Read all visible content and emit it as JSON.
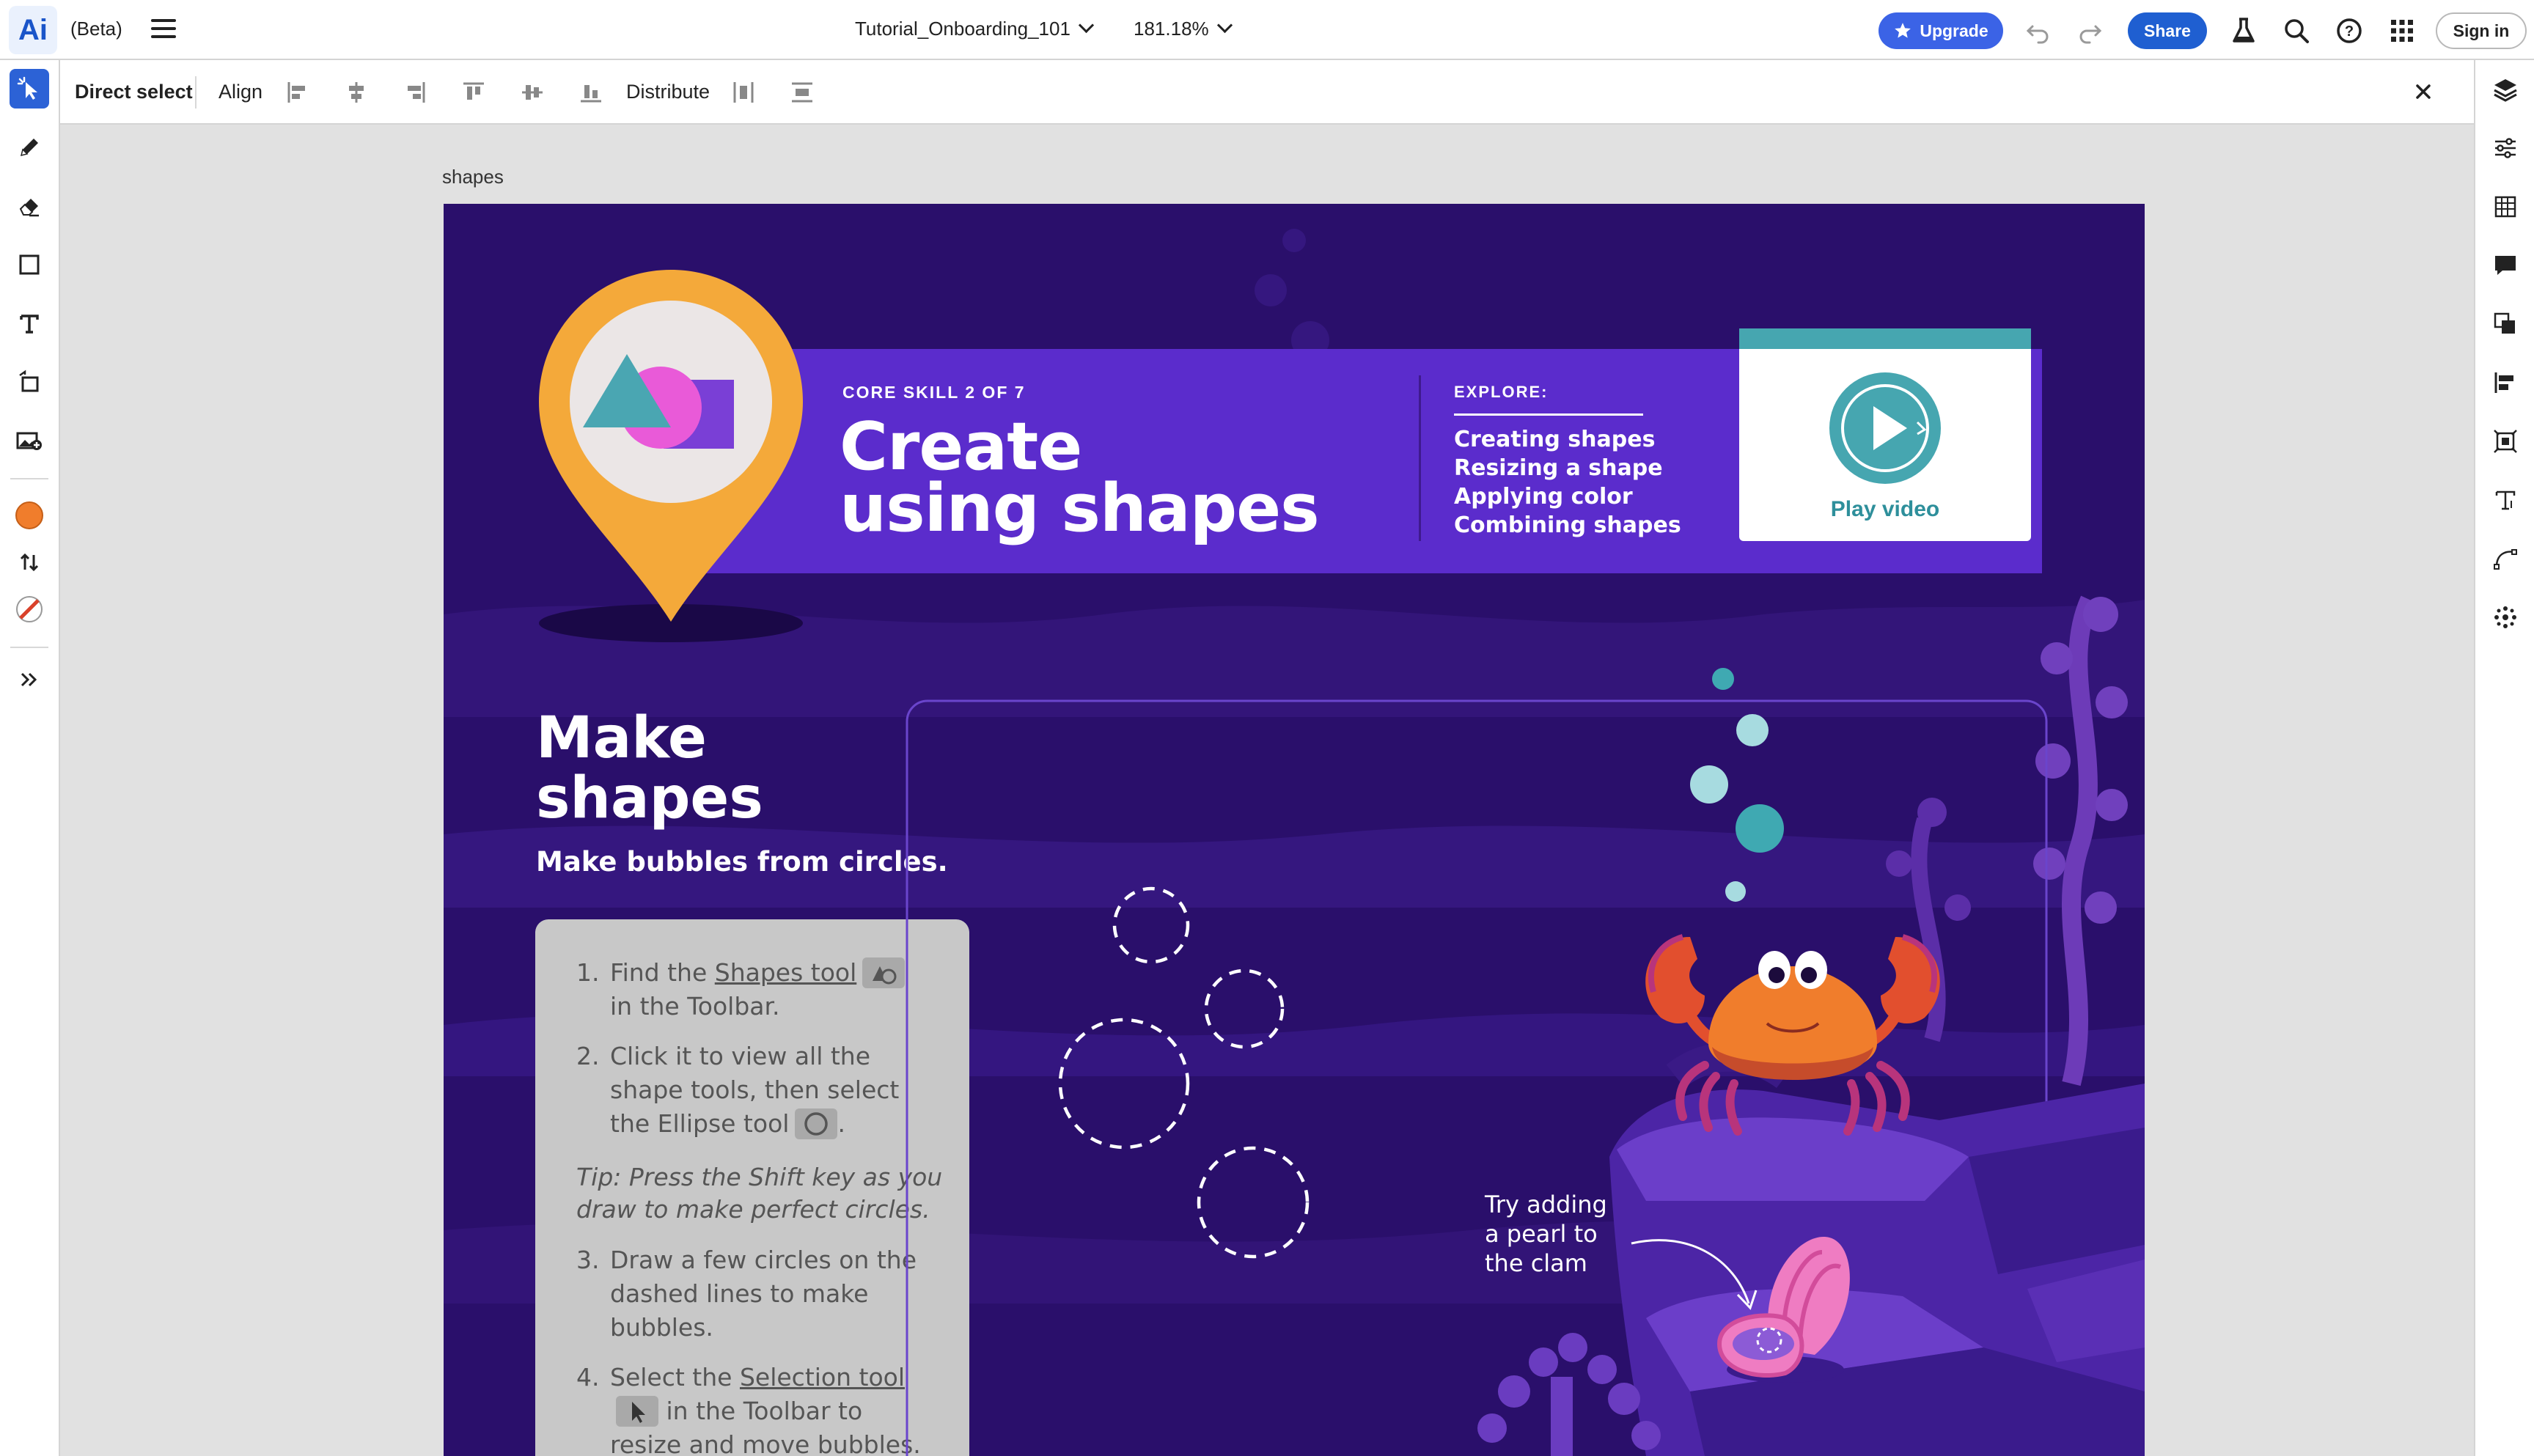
{
  "app": {
    "logo": "Ai",
    "beta_label": "(Beta)",
    "doc_name": "Tutorial_Onboarding_101",
    "zoom": "181.18%",
    "upgrade_label": "Upgrade",
    "share_label": "Share",
    "signin_label": "Sign in",
    "accent": "#1f5fd1"
  },
  "context_bar": {
    "tool_name": "Direct select",
    "align_label": "Align",
    "distribute_label": "Distribute"
  },
  "left_toolbar": {
    "tools": [
      "direct-select-icon",
      "pencil-icon",
      "eraser-icon",
      "rectangle-icon",
      "type-icon",
      "transform-icon",
      "image-icon"
    ],
    "fill_color": "#f07d2c",
    "stroke_color": "#d9412a"
  },
  "right_panel": {
    "icons": [
      "layers-icon",
      "properties-icon",
      "grid-icon",
      "comments-icon",
      "arrange-icon",
      "align-icon",
      "crop-icon",
      "type-panel-icon",
      "path-icon",
      "effects-icon"
    ]
  },
  "canvas": {
    "artboard_label": "shapes",
    "core_skill": "CORE SKILL 2 OF 7",
    "title_line1": "Create",
    "title_line2": "using shapes",
    "explore_label": "EXPLORE:",
    "explore_items": [
      "Creating shapes",
      "Resizing a shape",
      "Applying color",
      "Combining shapes"
    ],
    "play_video": "Play video",
    "make_line1": "Make",
    "make_line2": "shapes",
    "make_sub": "Make bubbles from circles.",
    "steps": [
      {
        "num": "1.",
        "a": "Find the ",
        "link": "Shapes tool",
        "b": " in the Toolbar."
      },
      {
        "num": "2.",
        "a": "Click it to view all the shape tools, then select the Ellipse tool",
        "b": "."
      },
      {
        "num": "3.",
        "a": "Draw a few circles on the dashed lines to make bubbles."
      },
      {
        "num": "4.",
        "a": "Select the ",
        "link": "Selection tool",
        "b": " in the Toolbar to resize and move bubbles."
      }
    ],
    "tip": "Tip: Press the Shift key as you draw to make perfect circles.",
    "pearl_note_1": "Try adding",
    "pearl_note_2": "a pearl to",
    "pearl_note_3": "the clam",
    "colors": {
      "ocean": "#2a0f6b",
      "banner": "#5b2ccc",
      "pin": "#f4a93a",
      "crab": "#f07d2c"
    }
  }
}
